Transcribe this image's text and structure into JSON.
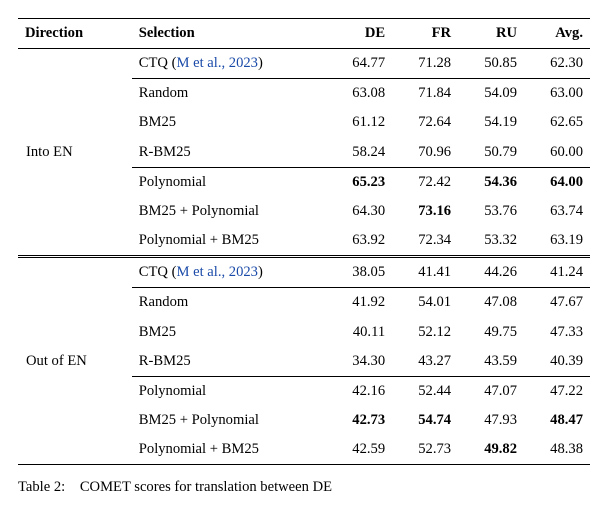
{
  "headers": {
    "direction": "Direction",
    "selection": "Selection",
    "de": "DE",
    "fr": "FR",
    "ru": "RU",
    "avg": "Avg."
  },
  "groups": [
    {
      "direction": "Into EN",
      "subgroups": [
        [
          {
            "selection_prefix": "CTQ (",
            "selection_link": "M et al., 2023",
            "selection_suffix": ")",
            "de": "64.77",
            "fr": "71.28",
            "ru": "50.85",
            "avg": "62.30"
          }
        ],
        [
          {
            "selection": "Random",
            "de": "63.08",
            "fr": "71.84",
            "ru": "54.09",
            "avg": "63.00"
          },
          {
            "selection": "BM25",
            "de": "61.12",
            "fr": "72.64",
            "ru": "54.19",
            "avg": "62.65"
          },
          {
            "selection": "R-BM25",
            "de": "58.24",
            "fr": "70.96",
            "ru": "50.79",
            "avg": "60.00"
          }
        ],
        [
          {
            "selection": "Polynomial",
            "de": "65.23",
            "fr": "72.42",
            "ru": "54.36",
            "avg": "64.00",
            "bold": {
              "de": true,
              "ru": true,
              "avg": true
            }
          },
          {
            "selection": "BM25 + Polynomial",
            "de": "64.30",
            "fr": "73.16",
            "ru": "53.76",
            "avg": "63.74",
            "bold": {
              "fr": true
            }
          },
          {
            "selection": "Polynomial + BM25",
            "de": "63.92",
            "fr": "72.34",
            "ru": "53.32",
            "avg": "63.19"
          }
        ]
      ]
    },
    {
      "direction": "Out of EN",
      "subgroups": [
        [
          {
            "selection_prefix": "CTQ (",
            "selection_link": "M et al., 2023",
            "selection_suffix": ")",
            "de": "38.05",
            "fr": "41.41",
            "ru": "44.26",
            "avg": "41.24"
          }
        ],
        [
          {
            "selection": "Random",
            "de": "41.92",
            "fr": "54.01",
            "ru": "47.08",
            "avg": "47.67"
          },
          {
            "selection": "BM25",
            "de": "40.11",
            "fr": "52.12",
            "ru": "49.75",
            "avg": "47.33"
          },
          {
            "selection": "R-BM25",
            "de": "34.30",
            "fr": "43.27",
            "ru": "43.59",
            "avg": "40.39"
          }
        ],
        [
          {
            "selection": "Polynomial",
            "de": "42.16",
            "fr": "52.44",
            "ru": "47.07",
            "avg": "47.22"
          },
          {
            "selection": "BM25 + Polynomial",
            "de": "42.73",
            "fr": "54.74",
            "ru": "47.93",
            "avg": "48.47",
            "bold": {
              "de": true,
              "fr": true,
              "avg": true
            }
          },
          {
            "selection": "Polynomial + BM25",
            "de": "42.59",
            "fr": "52.73",
            "ru": "49.82",
            "avg": "48.38",
            "bold": {
              "ru": true
            }
          }
        ]
      ]
    }
  ],
  "caption_prefix": "Table 2:",
  "caption_rest": "COMET scores for translation between DE"
}
